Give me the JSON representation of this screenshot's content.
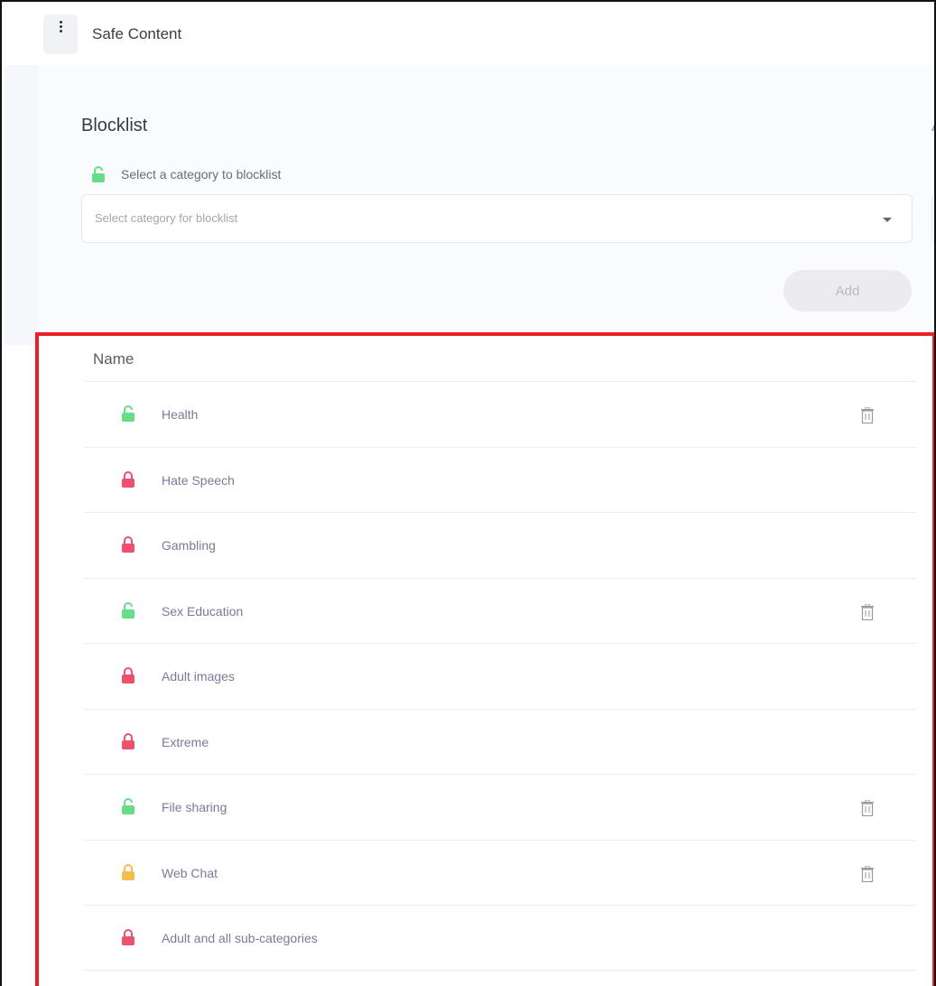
{
  "app": {
    "title": "Safe Content"
  },
  "blocklist": {
    "title": "Blocklist",
    "right_panel_title_partial": "A",
    "hint": "Select a category to blocklist",
    "select_placeholder": "Select category for blocklist",
    "add_label": "Add"
  },
  "table": {
    "header_name": "Name",
    "rows": [
      {
        "name": "Health",
        "lock": "open",
        "color": "#66dd88",
        "deletable": true
      },
      {
        "name": "Hate Speech",
        "lock": "closed",
        "color": "#f0506e",
        "deletable": false
      },
      {
        "name": "Gambling",
        "lock": "closed",
        "color": "#f0506e",
        "deletable": false
      },
      {
        "name": "Sex Education",
        "lock": "open",
        "color": "#66dd88",
        "deletable": true
      },
      {
        "name": "Adult images",
        "lock": "closed",
        "color": "#f0506e",
        "deletable": false
      },
      {
        "name": "Extreme",
        "lock": "closed",
        "color": "#f0506e",
        "deletable": false
      },
      {
        "name": "File sharing",
        "lock": "open",
        "color": "#66dd88",
        "deletable": true
      },
      {
        "name": "Web Chat",
        "lock": "closed",
        "color": "#f7bc4b",
        "deletable": true
      },
      {
        "name": "Adult and all sub-categories",
        "lock": "closed",
        "color": "#f0506e",
        "deletable": false
      }
    ]
  },
  "colors": {
    "lock_open": "#66dd88",
    "lock_closed": "#f0506e",
    "lock_warning": "#f7bc4b",
    "highlight_border": "#e8202a"
  }
}
